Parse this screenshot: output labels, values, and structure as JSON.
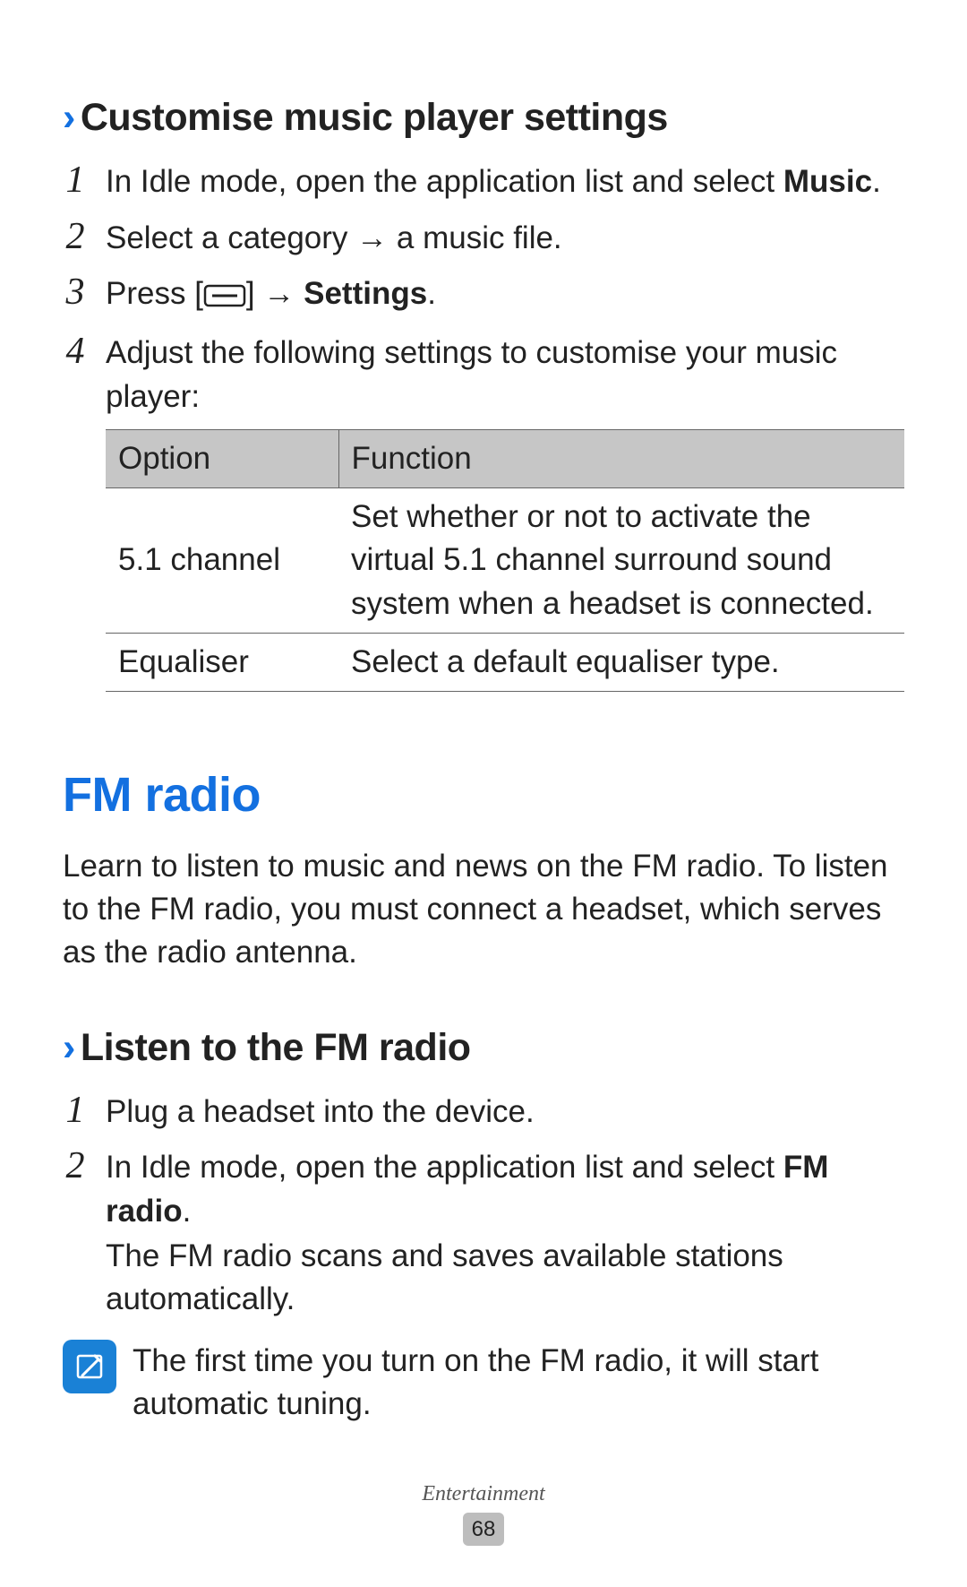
{
  "subheading1_prefix": "›",
  "subheading1": "Customise music player settings",
  "steps1": [
    {
      "num": "1",
      "text_before": "In Idle mode, open the application list and select ",
      "bold": "Music",
      "text_after": "."
    },
    {
      "num": "2",
      "text": "Select a category → a music file."
    },
    {
      "num": "3",
      "press_label": "Press [",
      "arrow": "] → ",
      "bold": "Settings",
      "text_after": "."
    },
    {
      "num": "4",
      "text": "Adjust the following settings to customise your music player:"
    }
  ],
  "table": {
    "headers": [
      "Option",
      "Function"
    ],
    "rows": [
      {
        "option": "5.1 channel",
        "function": "Set whether or not to activate the virtual 5.1 channel surround sound system when a headset is connected."
      },
      {
        "option": "Equaliser",
        "function": "Select a default equaliser type."
      }
    ]
  },
  "main_heading": "FM radio",
  "intro": "Learn to listen to music and news on the FM radio. To listen to the FM radio, you must connect a headset, which serves as the radio antenna.",
  "subheading2_prefix": "›",
  "subheading2": "Listen to the FM radio",
  "steps2": [
    {
      "num": "1",
      "text": "Plug a headset into the device."
    },
    {
      "num": "2",
      "text_before": "In Idle mode, open the application list and select ",
      "bold": "FM radio",
      "text_after": ".",
      "sub": "The FM radio scans and saves available stations automatically."
    }
  ],
  "note": "The first time you turn on the FM radio, it will start automatic tuning.",
  "footer_label": "Entertainment",
  "page_number": "68"
}
